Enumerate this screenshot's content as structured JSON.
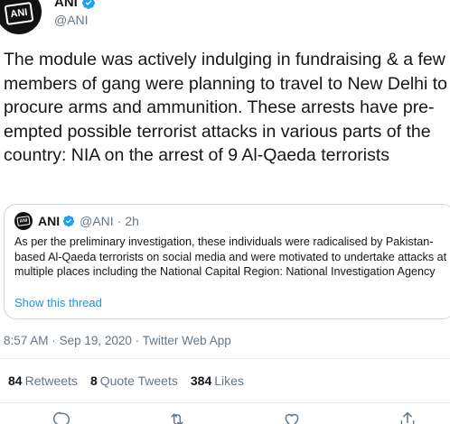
{
  "author": {
    "name": "ANI",
    "handle": "@ANI",
    "avatar_text": "ANI"
  },
  "tweet": {
    "text": "The module was actively indulging in fundraising & a few members of gang were planning to travel to New Delhi to procure arms and ammunition. These arrests have pre-empted possible terrorist attacks in various parts of the country: NIA on the arrest of 9 Al-Qaeda terrorists"
  },
  "quoted": {
    "name": "ANI",
    "handle": "@ANI",
    "separator": "·",
    "time": "2h",
    "text": "As per the preliminary investigation, these individuals were radicalised by Pakistan-based Al-Qaeda terrorists on social media and were motivated to undertake attacks at multiple places including the National Capital Region: National Investigation Agency",
    "show_thread": "Show this thread"
  },
  "meta": {
    "time": "8:57 AM",
    "date": "Sep 19, 2020",
    "source": "Twitter Web App",
    "separator": "·"
  },
  "stats": {
    "retweets_count": "84",
    "retweets_label": "Retweets",
    "quotes_count": "8",
    "quotes_label": "Quote Tweets",
    "likes_count": "384",
    "likes_label": "Likes"
  },
  "colors": {
    "verified": "#1da1f2",
    "link": "#1b95e0",
    "secondary_text": "#657786",
    "icon": "#657786"
  },
  "icons": [
    "verified-badge-icon",
    "reply-icon",
    "retweet-icon",
    "like-icon",
    "share-icon"
  ]
}
